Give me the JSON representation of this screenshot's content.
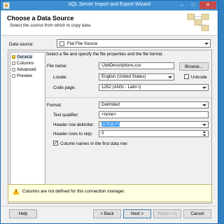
{
  "window": {
    "title": "SQL Server Import and Export Wizard"
  },
  "header": {
    "title": "Choose a Data Source",
    "subtitle": "Select the source from which to copy data."
  },
  "data_source": {
    "label": "Data source:",
    "value": "Flat File Source"
  },
  "nav": {
    "items": [
      {
        "label": "General",
        "icon": "warning-icon",
        "selected": true
      },
      {
        "label": "Columns",
        "icon": "page-icon"
      },
      {
        "label": "Advanced",
        "icon": "page-icon"
      },
      {
        "label": "Preview",
        "icon": "page-icon"
      }
    ]
  },
  "general": {
    "description": "Select a file and specify the file properties and the file format.",
    "file_name_label": "File name:",
    "file_name_value": "\\JobDescriptions.csv",
    "browse_label": "Browse...",
    "locale_label": "Locale:",
    "locale_value": "English (United States)",
    "unicode_label": "Unicode",
    "code_page_label": "Code page:",
    "code_page_value": "1252 (ANSI - Latin I)",
    "format_label": "Format:",
    "format_value": "Delimited",
    "text_qualifier_label": "Text qualifier:",
    "text_qualifier_value": "<none>",
    "header_row_delim_label": "Header row delimiter:",
    "header_row_delim_value": "{CR}{LF}",
    "header_rows_skip_label": "Header rows to skip:",
    "header_rows_skip_value": "0",
    "column_names_label": "Column names in the first data row"
  },
  "warning": {
    "text": "Columns are not defined for this connection manager."
  },
  "buttons": {
    "help": "Help",
    "back": "< Back",
    "next": "Next >",
    "finish": "Finish >>|",
    "cancel": "Cancel"
  },
  "colors": {
    "title_bar": "#3d8fd1",
    "selection": "#3399ff",
    "warning_bg": "#ffffe1"
  }
}
